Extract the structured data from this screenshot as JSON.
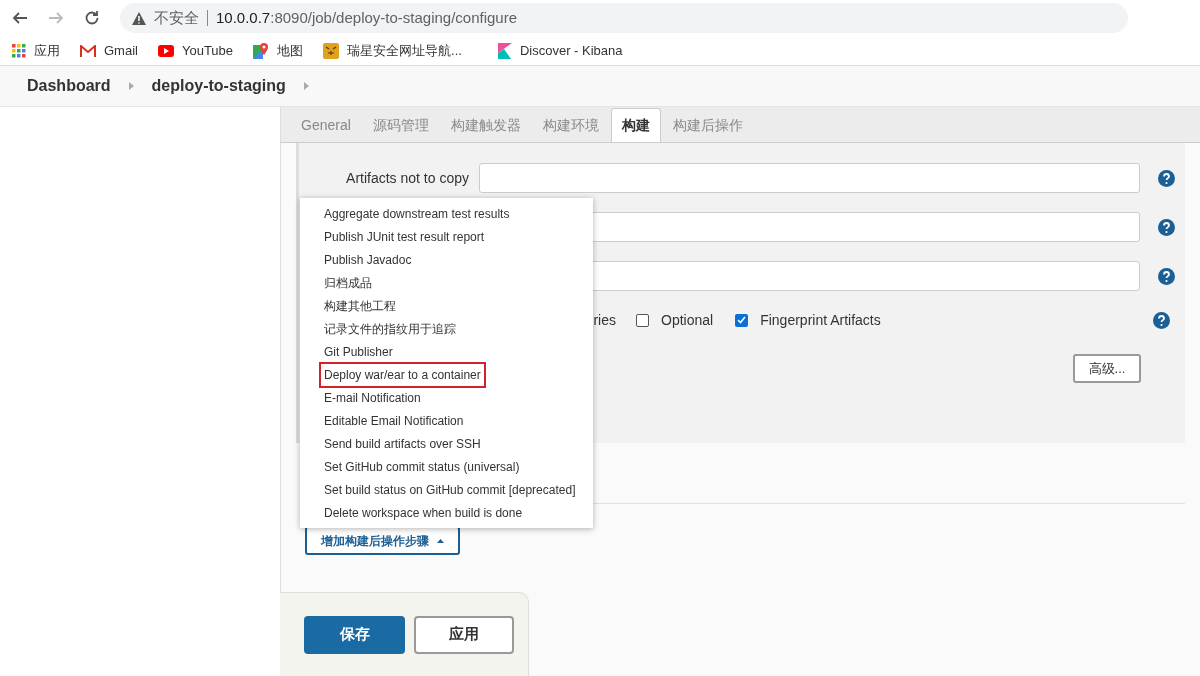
{
  "browser": {
    "security": "不安全",
    "url_host": "10.0.0.7",
    "url_rest": ":8090/job/deploy-to-staging/configure",
    "bookmarks": [
      {
        "kind": "apps",
        "label": "应用"
      },
      {
        "kind": "gmail",
        "label": "Gmail"
      },
      {
        "kind": "youtube",
        "label": "YouTube"
      },
      {
        "kind": "maps",
        "label": "地图"
      },
      {
        "kind": "tiger",
        "label": "瑞星安全网址导航..."
      },
      {
        "kind": "kibana",
        "label": "Discover - Kibana"
      }
    ]
  },
  "breadcrumbs": [
    "Dashboard",
    "deploy-to-staging"
  ],
  "tabs": [
    {
      "label": "General",
      "selected": false
    },
    {
      "label": "源码管理",
      "selected": false
    },
    {
      "label": "构建触发器",
      "selected": false
    },
    {
      "label": "构建环境",
      "selected": false
    },
    {
      "label": "构建",
      "selected": true
    },
    {
      "label": "构建后操作",
      "selected": false
    }
  ],
  "fields": [
    {
      "kind": "labeled",
      "label": "Artifacts not to copy"
    },
    {
      "kind": "plain"
    },
    {
      "kind": "plain"
    }
  ],
  "options": {
    "partial_label": "ries",
    "checkboxes": [
      {
        "label": "Optional",
        "checked": false
      },
      {
        "label": "Fingerprint Artifacts",
        "checked": true
      }
    ]
  },
  "advanced_button": "高级...",
  "add_step_button": "增加构建后操作步骤",
  "menu": [
    {
      "label": "Aggregate downstream test results",
      "highlighted": false
    },
    {
      "label": "Publish JUnit test result report",
      "highlighted": false
    },
    {
      "label": "Publish Javadoc",
      "highlighted": false
    },
    {
      "label": "归档成品",
      "highlighted": false
    },
    {
      "label": "构建其他工程",
      "highlighted": false
    },
    {
      "label": "记录文件的指纹用于追踪",
      "highlighted": false
    },
    {
      "label": "Git Publisher",
      "highlighted": false
    },
    {
      "label": "Deploy war/ear to a container",
      "highlighted": true
    },
    {
      "label": "E-mail Notification",
      "highlighted": false
    },
    {
      "label": "Editable Email Notification",
      "highlighted": false
    },
    {
      "label": "Send build artifacts over SSH",
      "highlighted": false
    },
    {
      "label": "Set GitHub commit status (universal)",
      "highlighted": false
    },
    {
      "label": "Set build status on GitHub commit [deprecated]",
      "highlighted": false
    },
    {
      "label": "Delete workspace when build is done",
      "highlighted": false
    }
  ],
  "save_button": "保存",
  "apply_button": "应用"
}
